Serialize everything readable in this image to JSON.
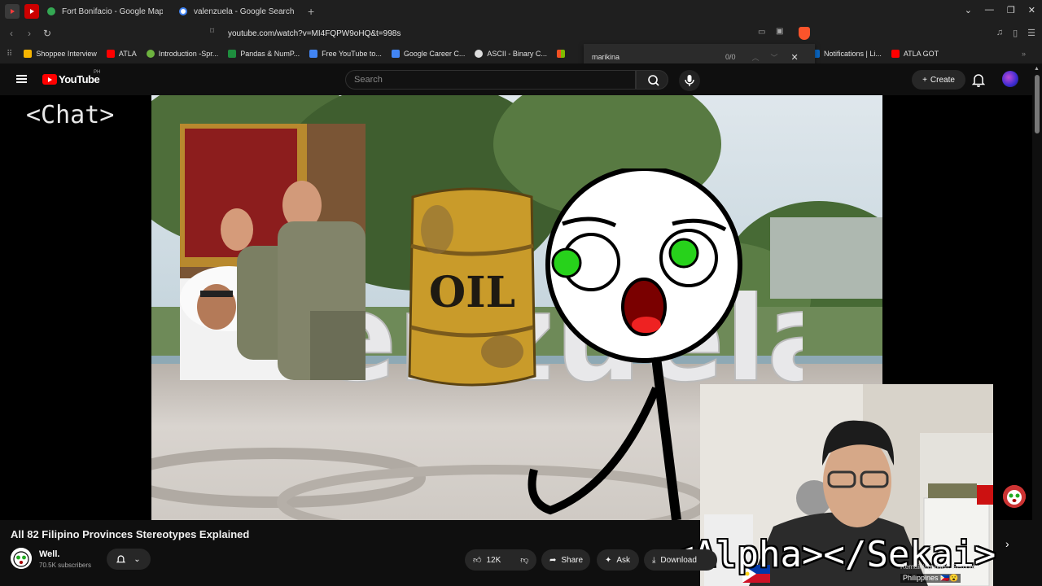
{
  "browser": {
    "tabs": [
      {
        "label": "Fort Bonifacio - Google Maps",
        "color": "#34a853"
      },
      {
        "label": "valenzuela - Google Search",
        "color": "#ffffff"
      }
    ],
    "url": "youtube.com/watch?v=MI4FQPW9oHQ&t=998s",
    "bookmarks": [
      {
        "label": "Shoppee Interview",
        "color": "#f5b400"
      },
      {
        "label": "ATLA",
        "color": "#ff0000"
      },
      {
        "label": "Introduction -Spr...",
        "color": "#6db33f"
      },
      {
        "label": "Pandas & NumP...",
        "color": "#1e8e3e"
      },
      {
        "label": "Free YouTube to...",
        "color": "#4285f4"
      },
      {
        "label": "Google Career C...",
        "color": "#4285f4"
      },
      {
        "label": "ASCII - Binary C...",
        "color": "#dddddd"
      }
    ],
    "bookmarks_right": [
      {
        "label": "Notifications | Li...",
        "color": "#0a66c2"
      },
      {
        "label": "ATLA GOT",
        "color": "#ff0000"
      }
    ],
    "find": {
      "query": "marikina",
      "count": "0/0"
    }
  },
  "youtube": {
    "logo_text": "YouTube",
    "region": "PH",
    "search_placeholder": "Search",
    "create_label": "Create"
  },
  "video": {
    "chat_label": "<Chat>",
    "barrel_text": "OIL",
    "overlay_text": "<Alpha></Sekai>",
    "caption_line1": "Remaining video: Remote",
    "caption_line2": "Philippines 🇵🇭😮",
    "title": "All 82 Filipino Provinces Stereotypes Explained"
  },
  "channel": {
    "name": "Well.",
    "subscribers": "70.5K subscribers"
  },
  "actions": {
    "likes": "12K",
    "share": "Share",
    "ask": "Ask",
    "download": "Download"
  }
}
